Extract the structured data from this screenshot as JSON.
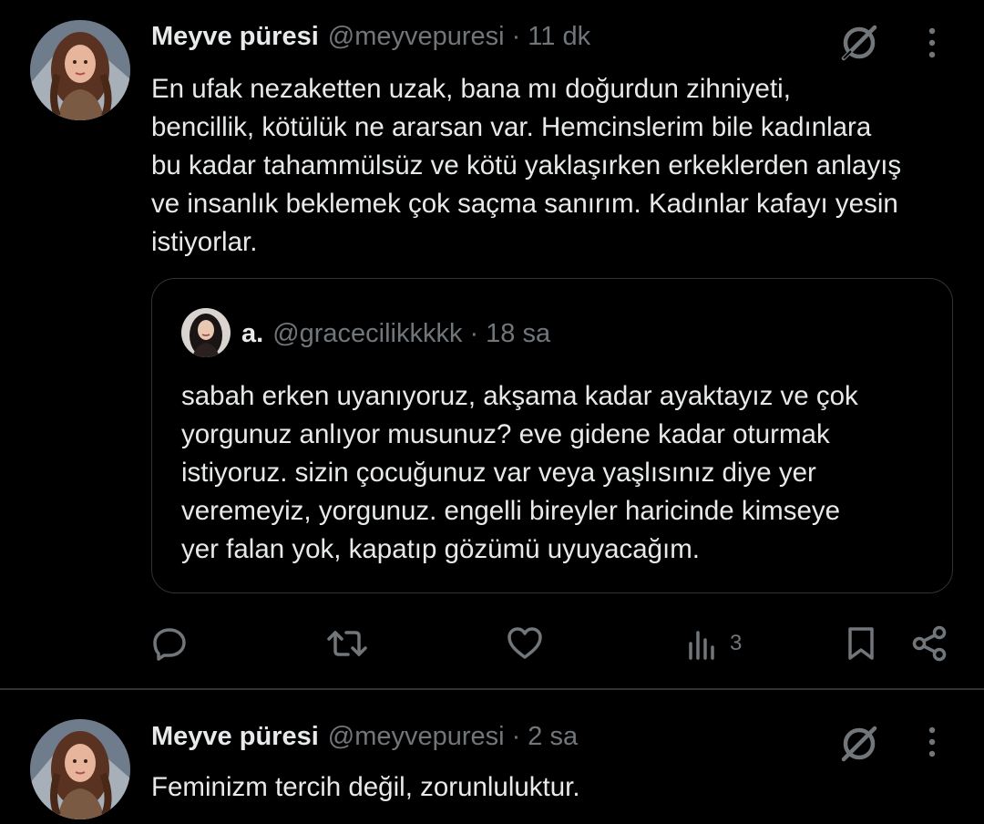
{
  "post1": {
    "author_name": "Meyve püresi",
    "handle": "@meyvepuresi",
    "separator": "·",
    "time": "11 dk",
    "text": "En ufak nezaketten uzak, bana mı doğurdun zihniyeti,\nbencillik, kötülük ne ararsan var. Hemcinslerim bile kadınlara\nbu kadar tahammülsüz ve kötü yaklaşırken erkeklerden anlayış\nve insanlık beklemek çok saçma sanırım. Kadınlar kafayı yesin\nistiyorlar.",
    "quote": {
      "author_name": "a.",
      "handle": "@gracecilikkkkk",
      "separator": "·",
      "time": "18 sa",
      "text": "sabah erken uyanıyoruz, akşama kadar ayaktayız ve çok\nyorgunuz anlıyor musunuz? eve gidene kadar oturmak\nistiyoruz. sizin çocuğunuz var veya yaşlısınız diye yer\nveremeyiz, yorgunuz. engelli bireyler haricinde kimseye\nyer falan yok, kapatıp gözümü uyuyacağım."
    },
    "actions": {
      "reply_icon": "reply-icon",
      "retweet_icon": "retweet-icon",
      "like_icon": "heart-icon",
      "views_icon": "views-icon",
      "views_count": "3",
      "bookmark_icon": "bookmark-icon",
      "share_icon": "share-icon"
    }
  },
  "post2": {
    "author_name": "Meyve püresi",
    "handle": "@meyvepuresi",
    "separator": "·",
    "time": "2 sa",
    "text": "Feminizm tercih değil, zorunluluktur."
  },
  "colors": {
    "background": "#000000",
    "text_primary": "#e7e9ea",
    "text_secondary": "#71767b",
    "border": "#2f3336"
  }
}
